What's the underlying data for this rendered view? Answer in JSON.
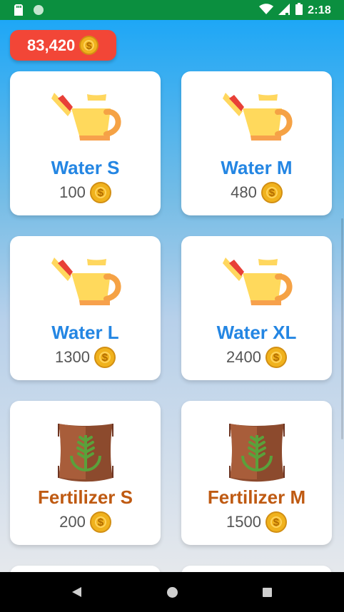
{
  "status_bar": {
    "time": "2:18",
    "icons": [
      "sd-card-icon",
      "notification-dot-icon",
      "wifi-icon",
      "signal-icon",
      "battery-icon"
    ]
  },
  "header": {
    "coins": "83,420",
    "coin_icon": "coin-icon"
  },
  "shop_items": [
    {
      "name": "Water S",
      "price": "100",
      "icon": "watering-can-icon"
    },
    {
      "name": "Water M",
      "price": "480",
      "icon": "watering-can-icon"
    },
    {
      "name": "Water L",
      "price": "1300",
      "icon": "watering-can-icon"
    },
    {
      "name": "Water XL",
      "price": "2400",
      "icon": "watering-can-icon"
    },
    {
      "name": "Fertilizer S",
      "price": "200",
      "icon": "fertilizer-bag-icon"
    },
    {
      "name": "Fertilizer M",
      "price": "1500",
      "icon": "fertilizer-bag-icon"
    }
  ],
  "colors": {
    "water_title": "#2486e3",
    "fertilizer_title": "#bf5a12",
    "coin_badge": "#f24637",
    "status_bar": "#0b8f3f"
  },
  "navigation": {
    "back": "back-icon",
    "home": "home-icon",
    "recent": "recent-apps-icon"
  }
}
